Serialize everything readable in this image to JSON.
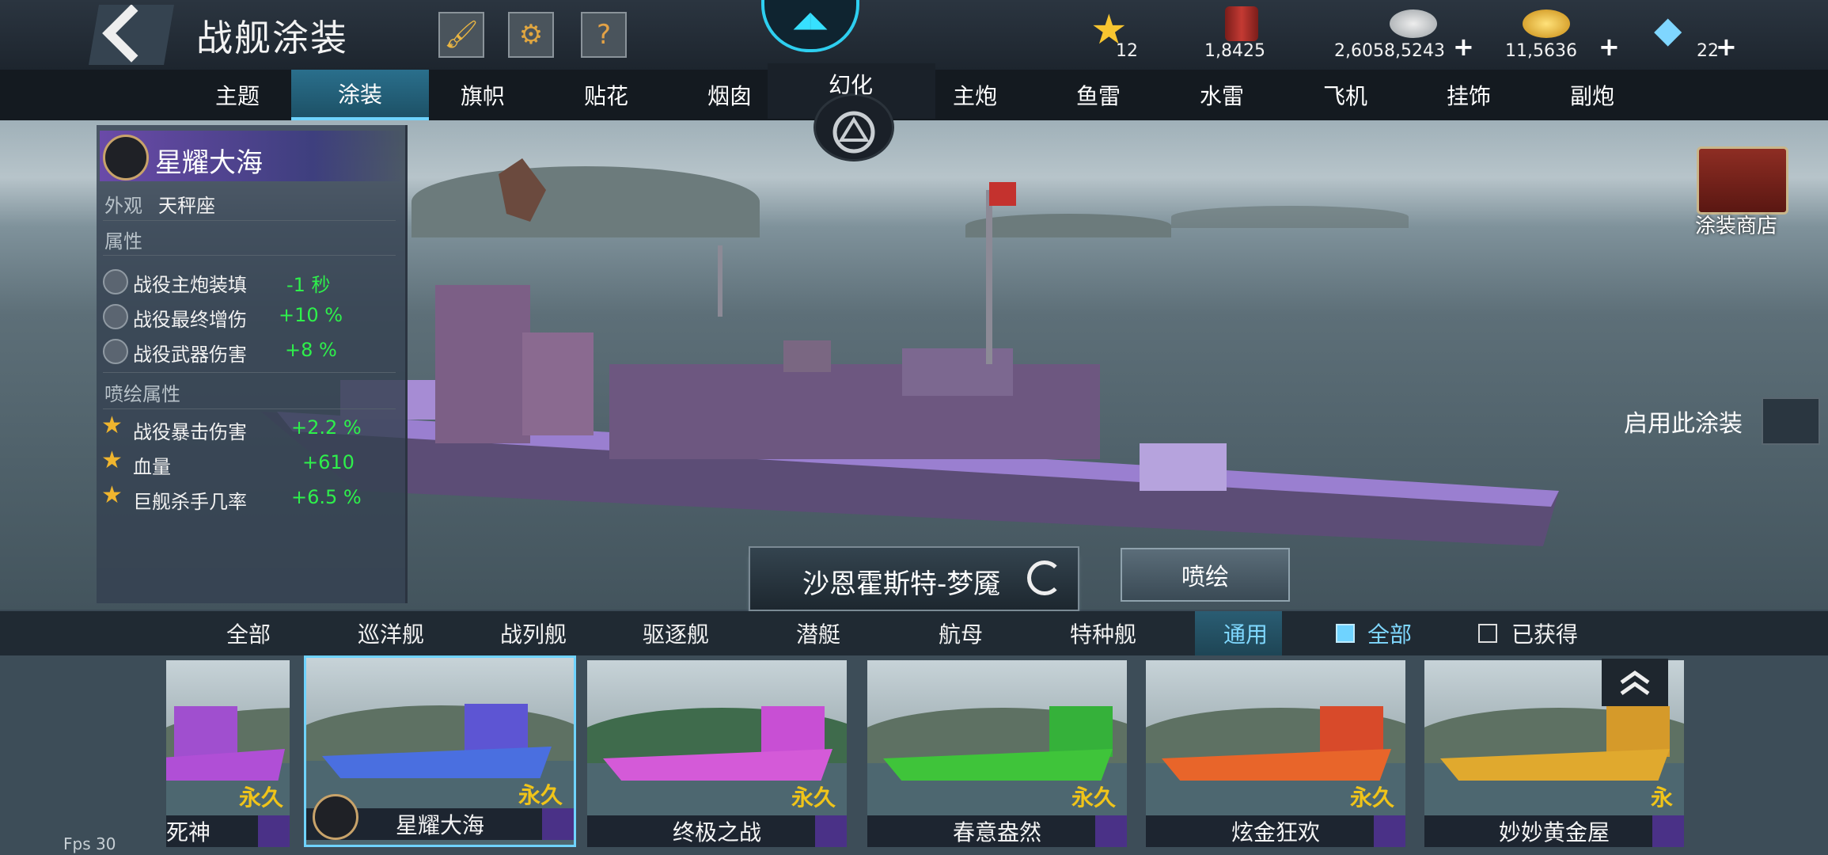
{
  "header": {
    "title": "战舰涂装",
    "icons": [
      "brush-icon",
      "gear-icon",
      "help-icon"
    ],
    "help_label": "?",
    "resources": [
      {
        "icon": "star-icon",
        "value": "12",
        "plus": false
      },
      {
        "icon": "paint-bucket-icon",
        "value": "1,8425",
        "plus": false
      },
      {
        "icon": "silver-coins-icon",
        "value": "2,6058,5243",
        "plus": true
      },
      {
        "icon": "gold-coins-icon",
        "value": "11,5636",
        "plus": true
      },
      {
        "icon": "diamonds-icon",
        "value": "22",
        "plus": true
      }
    ],
    "plus_label": "+"
  },
  "tabs": {
    "left": [
      "主题",
      "涂装",
      "旗帜",
      "贴花",
      "烟囱"
    ],
    "active": "涂装",
    "transform": "幻化",
    "right": [
      "主炮",
      "鱼雷",
      "水雷",
      "飞机",
      "挂饰",
      "副炮"
    ]
  },
  "info": {
    "skin_name": "星耀大海",
    "appearance_label": "外观",
    "appearance_value": "天秤座",
    "attr_heading": "属性",
    "attributes": [
      {
        "name": "战役主炮装填",
        "value": "-1 秒"
      },
      {
        "name": "战役最终增伤",
        "value": "+10 %"
      },
      {
        "name": "战役武器伤害",
        "value": "+8 %"
      }
    ],
    "spray_heading": "喷绘属性",
    "spray_attributes": [
      {
        "name": "战役暴击伤害",
        "value": "+2.2 %"
      },
      {
        "name": "血量",
        "value": "+610"
      },
      {
        "name": "巨舰杀手几率",
        "value": "+6.5 %"
      }
    ]
  },
  "ship_name": "沙恩霍斯特-梦魇",
  "paint_button": "喷绘",
  "apply_label": "启用此涂装",
  "shop_label": "涂装商店",
  "filters": {
    "categories": [
      "全部",
      "巡洋舰",
      "战列舰",
      "驱逐舰",
      "潜艇",
      "航母",
      "特种舰",
      "通用"
    ],
    "active": "通用",
    "checkbox_all": "全部",
    "checkbox_owned": "已获得"
  },
  "cards": [
    {
      "name": "死神",
      "tag": "永久",
      "hull": "#b04fd6"
    },
    {
      "name": "星耀大海",
      "tag": "永久",
      "hull": "#4a6fe0"
    },
    {
      "name": "终极之战",
      "tag": "永久",
      "hull": "#d45ad8"
    },
    {
      "name": "春意盎然",
      "tag": "永久",
      "hull": "#3fc43a"
    },
    {
      "name": "炫金狂欢",
      "tag": "永久",
      "hull": "#e8652a"
    },
    {
      "name": "妙妙黄金屋",
      "tag": "永",
      "hull": "#e0a92e"
    }
  ],
  "fps": "Fps 30"
}
